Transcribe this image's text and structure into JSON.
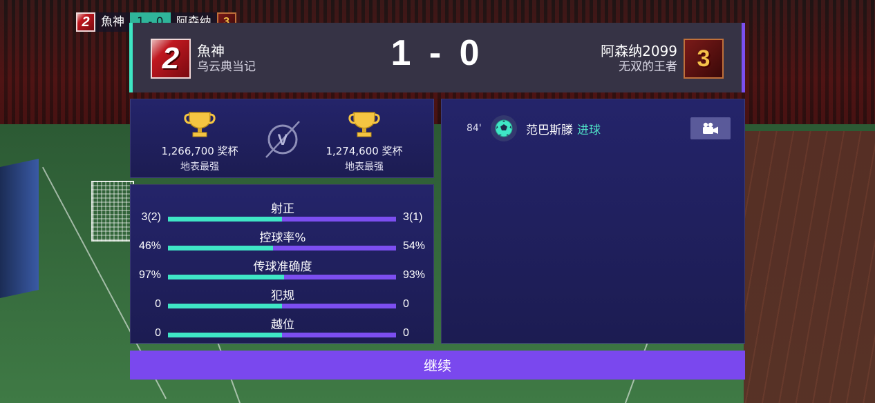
{
  "mini_score": {
    "home_rank": "2",
    "home_name": "魚神",
    "score": "1 - 0",
    "away_name": "阿森纳",
    "away_rank": "3"
  },
  "header": {
    "home": {
      "rank": "2",
      "name": "魚神",
      "sub": "乌云典当记"
    },
    "score": "1 - 0",
    "away": {
      "rank": "3",
      "name": "阿森纳2099",
      "sub": "无双的王者"
    }
  },
  "trophies": {
    "home": {
      "count": "1,266,700 奖杯",
      "rank": "地表最强"
    },
    "away": {
      "count": "1,274,600 奖杯",
      "rank": "地表最强"
    },
    "vs": "V"
  },
  "stats": [
    {
      "label": "射正",
      "left": "3(2)",
      "right": "3(1)",
      "home_share": 0.5
    },
    {
      "label": "控球率%",
      "left": "46%",
      "right": "54%",
      "home_share": 0.46
    },
    {
      "label": "传球准确度",
      "left": "97%",
      "right": "93%",
      "home_share": 0.51
    },
    {
      "label": "犯规",
      "left": "0",
      "right": "0",
      "home_share": 0.5
    },
    {
      "label": "越位",
      "left": "0",
      "right": "0",
      "home_share": 0.5
    }
  ],
  "events": [
    {
      "minute": "84'",
      "player": "范巴斯滕",
      "type": "进球"
    }
  ],
  "continue_label": "继续",
  "colors": {
    "accent_home": "#3fe6c6",
    "accent_away": "#7c4ef0",
    "button": "#7a48ee",
    "panel": "#22225f"
  },
  "icons": {
    "trophy": "trophy-icon",
    "vs": "vs-icon",
    "ball": "soccer-ball-icon",
    "video": "video-camera-icon"
  }
}
